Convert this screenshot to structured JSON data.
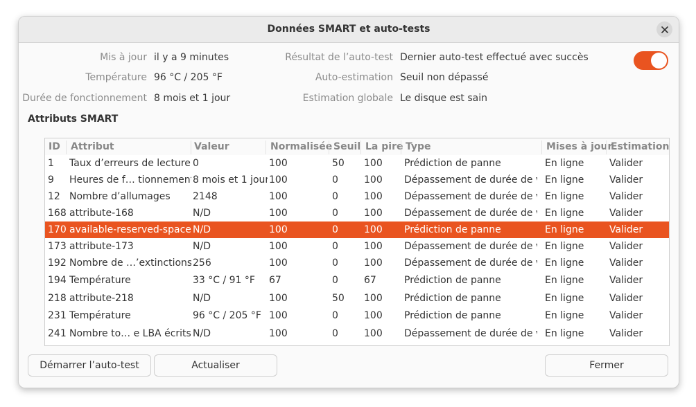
{
  "window": {
    "title": "Données SMART et auto-tests"
  },
  "info": [
    {
      "label": "Mis à jour",
      "value": "il y a 9 minutes"
    },
    {
      "label": "Température",
      "value": "96 °C / 205 °F"
    },
    {
      "label": "Durée de fonctionnement",
      "value": "8 mois et 1 jour"
    },
    {
      "label": "Résultat de l’auto-test",
      "value": "Dernier auto-test effectué avec succès"
    },
    {
      "label": "Auto-estimation",
      "value": "Seuil non dépassé"
    },
    {
      "label": "Estimation globale",
      "value": "Le disque est sain"
    }
  ],
  "toggle": {
    "on": true,
    "color": "#e95420"
  },
  "section": {
    "title": "Attributs SMART"
  },
  "table": {
    "headers": [
      "ID",
      "Attribut",
      "Valeur",
      "Normalisée",
      "Seuil",
      "La pire",
      "Type",
      "Mises à jour",
      "Estimation"
    ],
    "selected_index": 4,
    "rows": [
      [
        "1",
        "Taux d’erreurs de lecture",
        "0",
        "100",
        "50",
        "100",
        "Prédiction de panne",
        "En ligne",
        "Valider"
      ],
      [
        "9",
        "Heures de f… tionnement",
        "8 mois et 1 jour",
        "100",
        "0",
        "100",
        "Dépassement de durée de vie",
        "En ligne",
        "Valider"
      ],
      [
        "12",
        "Nombre d’allumages",
        "2148",
        "100",
        "0",
        "100",
        "Dépassement de durée de vie",
        "En ligne",
        "Valider"
      ],
      [
        "168",
        "attribute-168",
        "N/D",
        "100",
        "0",
        "100",
        "Dépassement de durée de vie",
        "En ligne",
        "Valider"
      ],
      [
        "170",
        "available-reserved-space",
        "N/D",
        "100",
        "0",
        "100",
        "Prédiction de panne",
        "En ligne",
        "Valider"
      ],
      [
        "173",
        "attribute-173",
        "N/D",
        "100",
        "0",
        "100",
        "Dépassement de durée de vie",
        "En ligne",
        "Valider"
      ],
      [
        "192",
        "Nombre de …’extinctions",
        "256",
        "100",
        "0",
        "100",
        "Dépassement de durée de vie",
        "En ligne",
        "Valider"
      ],
      [
        "194",
        "Température",
        "33 °C / 91 °F",
        "67",
        "0",
        "67",
        "Prédiction de panne",
        "En ligne",
        "Valider"
      ],
      [
        "218",
        "attribute-218",
        "N/D",
        "100",
        "50",
        "100",
        "Prédiction de panne",
        "En ligne",
        "Valider"
      ],
      [
        "231",
        "Température",
        "96 °C / 205 °F",
        "100",
        "0",
        "100",
        "Prédiction de panne",
        "En ligne",
        "Valider"
      ],
      [
        "241",
        "Nombre to… e LBA écrits",
        "N/D",
        "100",
        "0",
        "100",
        "Dépassement de durée de vie",
        "En ligne",
        "Valider"
      ]
    ]
  },
  "buttons": {
    "start_selftest": "Démarrer l’auto-test",
    "refresh": "Actualiser",
    "close": "Fermer"
  },
  "accent_color": "#e95420"
}
